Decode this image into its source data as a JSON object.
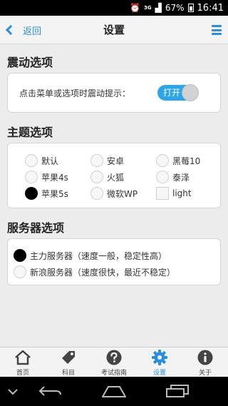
{
  "status_bar": {
    "alarm_icon": "alarm-clock-icon",
    "network": "3G",
    "signal_icon": "signal-icon",
    "battery": "67%",
    "time": "16:41"
  },
  "nav": {
    "back_label": "返回",
    "title": "设置",
    "menu_icon": "hamburger-menu-icon"
  },
  "vibration": {
    "title": "震动选项",
    "label": "点击菜单或选项时震动提示：",
    "toggle_label": "打开",
    "toggle_on": true
  },
  "theme": {
    "title": "主题选项",
    "options": [
      {
        "label": "默认",
        "selected": false
      },
      {
        "label": "安卓",
        "selected": false
      },
      {
        "label": "黑莓10",
        "selected": false
      },
      {
        "label": "苹果4s",
        "selected": false
      },
      {
        "label": "火狐",
        "selected": false
      },
      {
        "label": "泰泽",
        "selected": false
      },
      {
        "label": "苹果5s",
        "selected": true
      },
      {
        "label": "微软WP",
        "selected": false
      },
      {
        "label": "light",
        "selected": false
      }
    ]
  },
  "server": {
    "title": "服务器选项",
    "options": [
      {
        "label": "主力服务器（速度一般，稳定性高）",
        "selected": true
      },
      {
        "label": "新浪服务器（速度很快，最近不稳定）",
        "selected": false
      }
    ]
  },
  "tabs": [
    {
      "label": "首页",
      "icon": "home-icon",
      "active": false
    },
    {
      "label": "科目",
      "icon": "tag-icon",
      "active": false
    },
    {
      "label": "考试指南",
      "icon": "help-icon",
      "active": false
    },
    {
      "label": "设置",
      "icon": "gear-icon",
      "active": true
    },
    {
      "label": "关于",
      "icon": "info-icon",
      "active": false
    }
  ],
  "colors": {
    "accent": "#2a8ee0",
    "toggle_on": "#2ca6e8",
    "background": "#ececec"
  }
}
